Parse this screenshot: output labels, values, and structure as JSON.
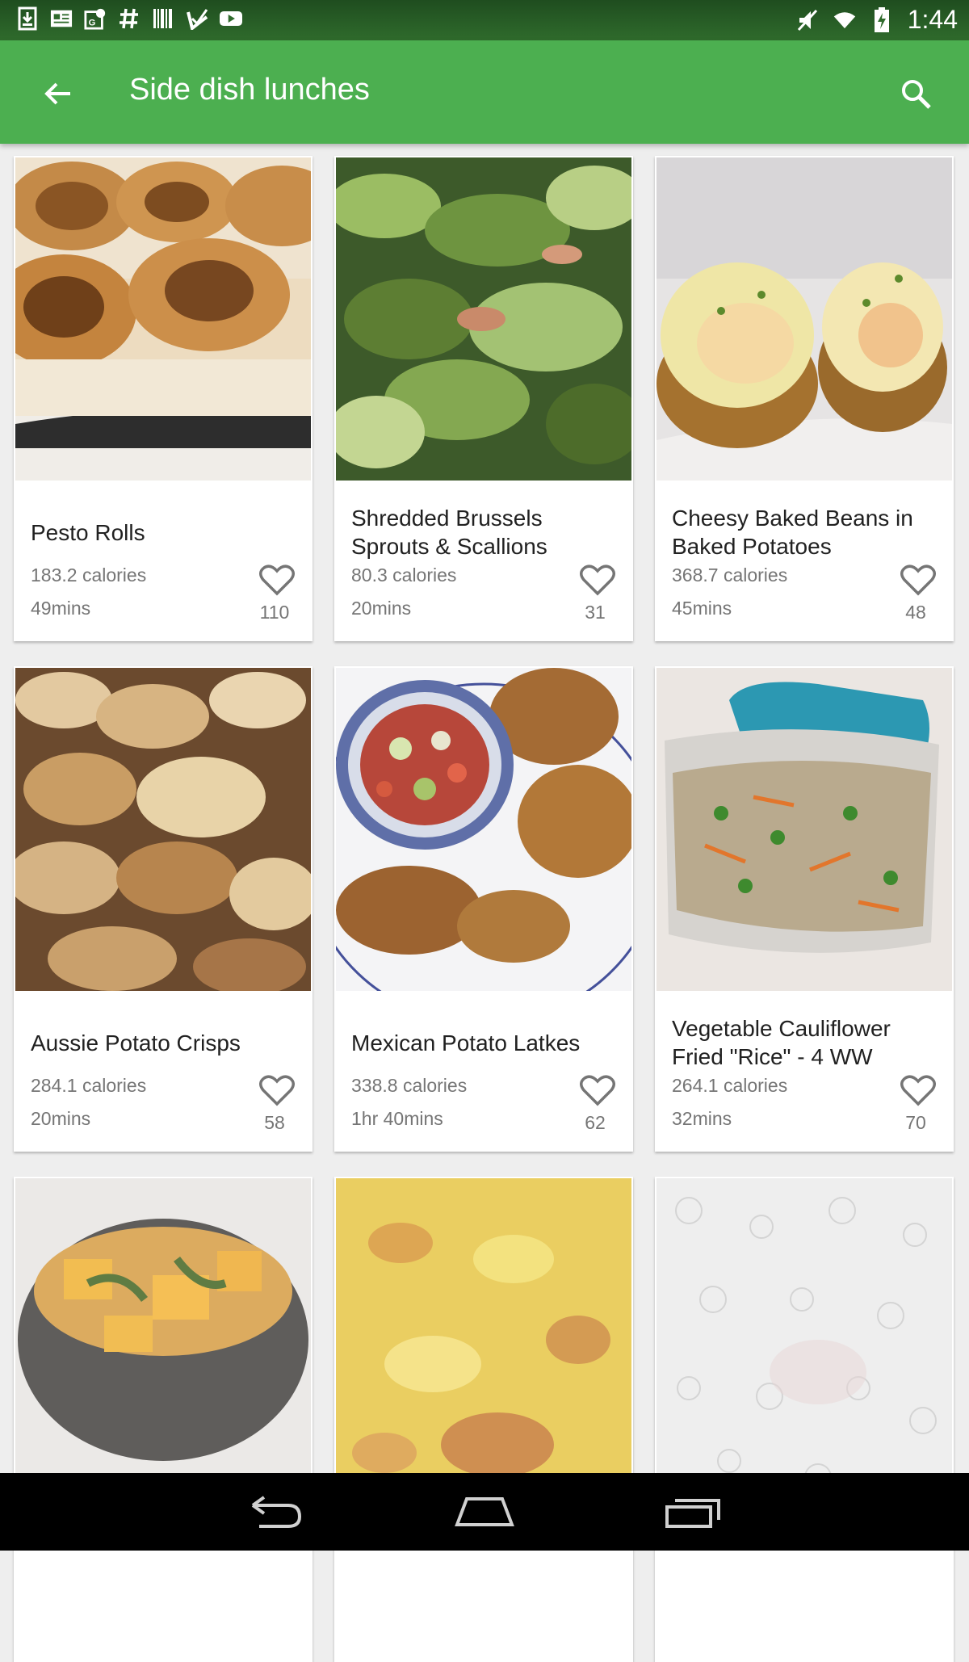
{
  "status_bar": {
    "time": "1:44",
    "left_icons": [
      "download-icon",
      "news-icon",
      "maps-icon",
      "hashtag-icon",
      "barcode-icon",
      "inbox-check-icon",
      "youtube-icon"
    ],
    "right_icons": [
      "mute-icon",
      "wifi-icon",
      "battery-icon"
    ]
  },
  "app_bar": {
    "title": "Side dish lunches",
    "back_icon": "arrow-left-icon",
    "search_icon": "search-icon",
    "color": "#4caf50"
  },
  "recipes": [
    {
      "name": "Pesto Rolls",
      "calories": "183.2 calories",
      "time": "49mins",
      "likes": "110",
      "image": "pesto-rolls-photo"
    },
    {
      "name": "Shredded Brussels Sprouts & Scallions",
      "calories": "80.3 calories",
      "time": "20mins",
      "likes": "31",
      "image": "brussels-sprouts-photo"
    },
    {
      "name": "Cheesy Baked Beans in Baked Potatoes",
      "calories": "368.7 calories",
      "time": "45mins",
      "likes": "48",
      "image": "baked-potatoes-photo"
    },
    {
      "name": "Aussie Potato Crisps",
      "calories": "284.1 calories",
      "time": "20mins",
      "likes": "58",
      "image": "potato-crisps-photo"
    },
    {
      "name": "Mexican Potato Latkes",
      "calories": "338.8 calories",
      "time": "1hr 40mins",
      "likes": "62",
      "image": "potato-latkes-photo"
    },
    {
      "name": "Vegetable Cauliflower Fried \"Rice\" - 4 WW",
      "calories": "264.1 calories",
      "time": "32mins",
      "likes": "70",
      "image": "cauliflower-rice-photo"
    }
  ],
  "partial_recipes": [
    {
      "image": "squash-bowl-photo"
    },
    {
      "image": "cheese-bake-photo"
    },
    {
      "image": "placeholder-pattern"
    }
  ],
  "nav_bar": {
    "icons": [
      "back-nav-icon",
      "home-nav-icon",
      "recents-nav-icon"
    ]
  }
}
